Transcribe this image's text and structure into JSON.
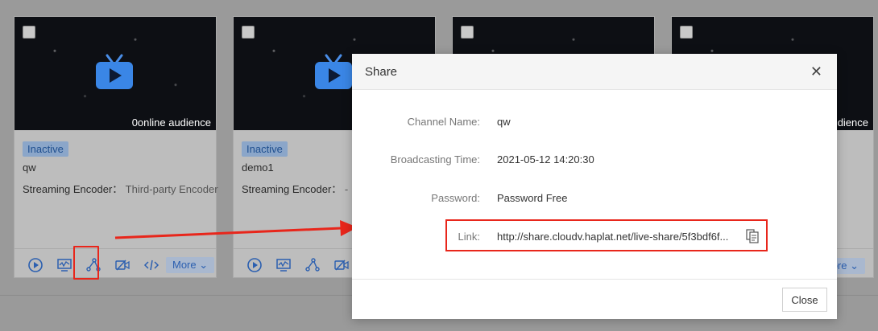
{
  "cards": [
    {
      "audience": "0online audience",
      "status": "Inactive",
      "name": "qw",
      "encoder_label": "Streaming Encoder：",
      "encoder_value": "Third-party Encoder",
      "more_label": "More ⌄"
    },
    {
      "audience": "",
      "status": "Inactive",
      "name": "demo1",
      "encoder_label": "Streaming Encoder：",
      "encoder_value": "-",
      "more_label": "More ⌄"
    },
    {
      "audience": "",
      "status": "",
      "name": "",
      "encoder_label": "",
      "encoder_value": "",
      "more_label": ""
    },
    {
      "audience": "dience",
      "status": "",
      "name": "",
      "encoder_label": "",
      "encoder_value": "",
      "more_label": "ore ⌄"
    }
  ],
  "modal": {
    "title": "Share",
    "close_icon": "✕",
    "fields": {
      "channel_name": {
        "label": "Channel Name:",
        "value": "qw"
      },
      "broadcasting_time": {
        "label": "Broadcasting Time:",
        "value": "2021-05-12 14:20:30"
      },
      "password": {
        "label": "Password:",
        "value": "Password Free"
      },
      "link": {
        "label": "Link:",
        "value": "http://share.cloudv.haplat.net/live-share/5f3bdf6f..."
      }
    },
    "close_button": "Close"
  },
  "colors": {
    "accent": "#2b5fb0",
    "annotation": "#e8261b",
    "overlay": "#9a9a9a"
  }
}
